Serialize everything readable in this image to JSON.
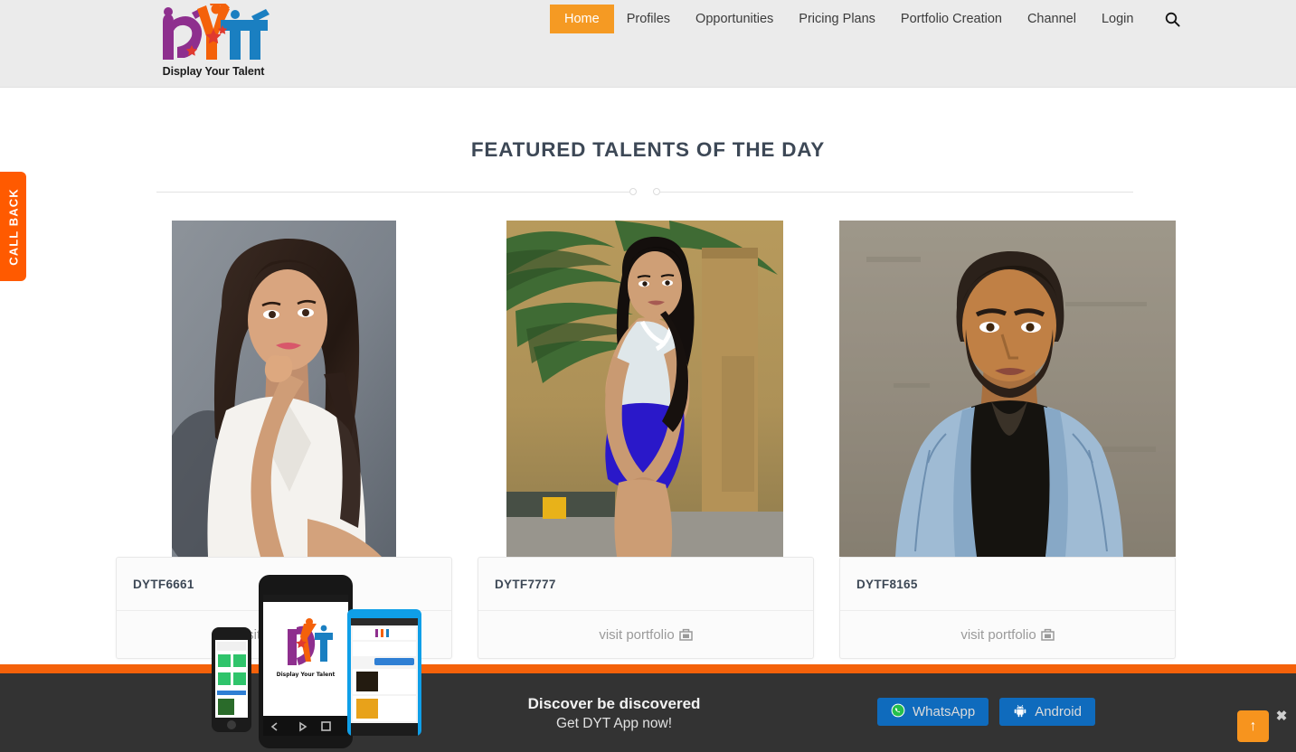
{
  "brand": {
    "logo_caption": "Display Your Talent",
    "accent_orange": "#f59a23",
    "accent_orange_dark": "#f4610a",
    "accent_blue": "#0f6bbd",
    "heading_color": "#3d4856",
    "header_bg": "#ebebeb",
    "banner_bg": "#333333"
  },
  "header": {
    "nav": [
      {
        "label": "Home",
        "active": true
      },
      {
        "label": "Profiles",
        "active": false
      },
      {
        "label": "Opportunities",
        "active": false
      },
      {
        "label": "Pricing Plans",
        "active": false
      },
      {
        "label": "Portfolio Creation",
        "active": false
      },
      {
        "label": "Channel",
        "active": false
      },
      {
        "label": "Login",
        "active": false
      }
    ],
    "search_icon": "search-icon"
  },
  "callback_tab": {
    "label": "CALL BACK"
  },
  "section": {
    "title": "FEATURED TALENTS OF THE DAY"
  },
  "cards": [
    {
      "id": "DYTF6661",
      "cta": "visit portfolio",
      "cta_icon": "briefcase-icon"
    },
    {
      "id": "DYTF7777",
      "cta": "visit portfolio",
      "cta_icon": "briefcase-icon"
    },
    {
      "id": "DYTF8165",
      "cta": "visit portfolio",
      "cta_icon": "briefcase-icon"
    }
  ],
  "app_banner": {
    "headline": "Discover be discovered",
    "subline": "Get DYT App now!",
    "buttons": [
      {
        "label": "WhatsApp",
        "icon": "whatsapp-icon"
      },
      {
        "label": "Android",
        "icon": "android-icon"
      }
    ],
    "close_icon": "close-icon"
  },
  "back_to_top": {
    "icon": "arrow-up-icon",
    "label": "↑"
  }
}
